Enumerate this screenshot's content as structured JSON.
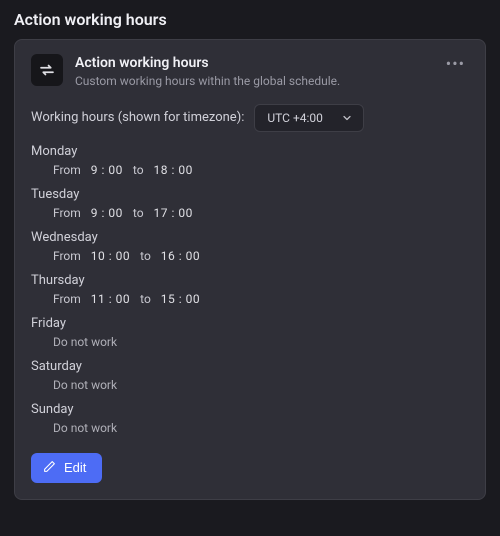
{
  "page_title": "Action working hours",
  "card": {
    "title": "Action working hours",
    "subtitle": "Custom working hours within the global schedule.",
    "tz_label": "Working hours (shown for timezone):",
    "tz_value": "UTC +4:00",
    "labels": {
      "from": "From",
      "to": "to",
      "do_not_work": "Do not work"
    },
    "days": [
      {
        "name": "Monday",
        "works": true,
        "from": "9 : 00",
        "to": "18 : 00"
      },
      {
        "name": "Tuesday",
        "works": true,
        "from": "9 : 00",
        "to": "17 : 00"
      },
      {
        "name": "Wednesday",
        "works": true,
        "from": "10 : 00",
        "to": "16 : 00"
      },
      {
        "name": "Thursday",
        "works": true,
        "from": "11 : 00",
        "to": "15 : 00"
      },
      {
        "name": "Friday",
        "works": false
      },
      {
        "name": "Saturday",
        "works": false
      },
      {
        "name": "Sunday",
        "works": false
      }
    ],
    "edit_label": "Edit"
  }
}
